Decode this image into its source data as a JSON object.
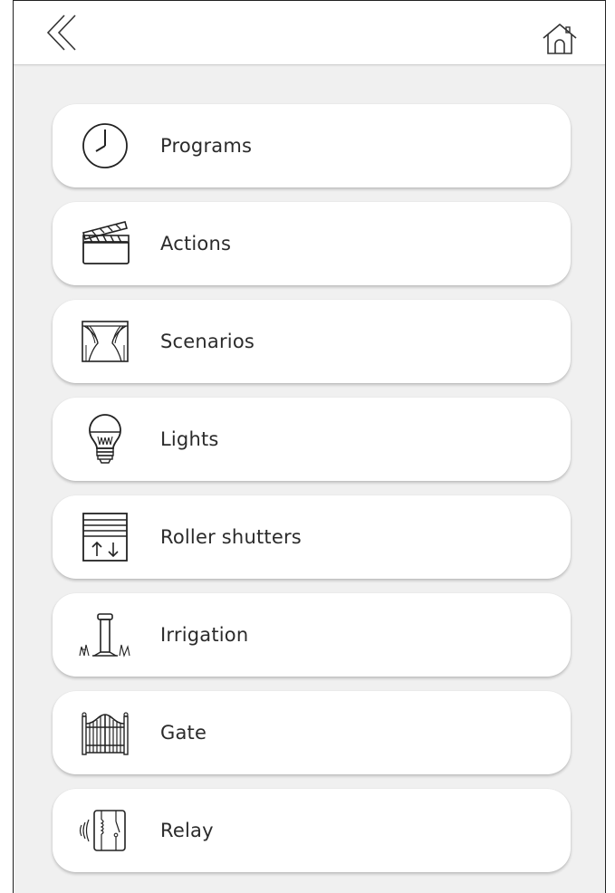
{
  "header": {
    "back_icon": "double-chevron-left-icon",
    "home_icon": "home-icon"
  },
  "menu": {
    "items": [
      {
        "label": "Programs",
        "icon": "clock-icon"
      },
      {
        "label": "Actions",
        "icon": "clapperboard-icon"
      },
      {
        "label": "Scenarios",
        "icon": "curtains-icon"
      },
      {
        "label": "Lights",
        "icon": "light-bulb-icon"
      },
      {
        "label": "Roller shutters",
        "icon": "roller-shutter-icon"
      },
      {
        "label": "Irrigation",
        "icon": "sprinkler-icon"
      },
      {
        "label": "Gate",
        "icon": "gate-icon"
      },
      {
        "label": "Relay",
        "icon": "relay-icon"
      }
    ]
  },
  "colors": {
    "background": "#f0f0f0",
    "card": "#ffffff",
    "text": "#2b2b2b",
    "icon_stroke": "#222222"
  }
}
